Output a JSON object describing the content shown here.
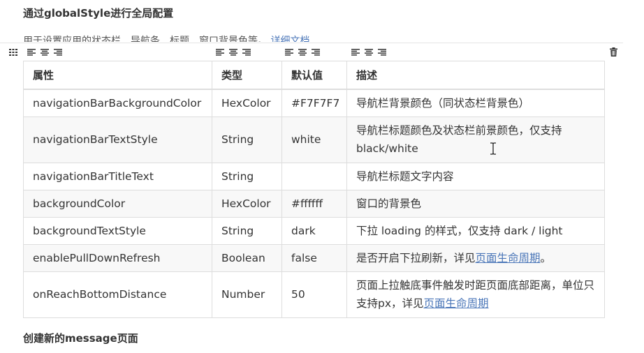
{
  "section_title": "通过globalStyle进行全局配置",
  "intro": {
    "text": "用于设置应用的状态栏、导航条、标题、窗口背景色等。",
    "link": "详细文档"
  },
  "table": {
    "headers": [
      "属性",
      "类型",
      "默认值",
      "描述"
    ],
    "rows": [
      {
        "prop": "navigationBarBackgroundColor",
        "type": "HexColor",
        "default": "#F7F7F7",
        "desc": "导航栏背景颜色（同状态栏背景色）",
        "link": ""
      },
      {
        "prop": "navigationBarTextStyle",
        "type": "String",
        "default": "white",
        "desc": "导航栏标题颜色及状态栏前景颜色，仅支持 black/white",
        "link": ""
      },
      {
        "prop": "navigationBarTitleText",
        "type": "String",
        "default": "",
        "desc": "导航栏标题文字内容",
        "link": ""
      },
      {
        "prop": "backgroundColor",
        "type": "HexColor",
        "default": "#ffffff",
        "desc": "窗口的背景色",
        "link": ""
      },
      {
        "prop": "backgroundTextStyle",
        "type": "String",
        "default": "dark",
        "desc": "下拉 loading 的样式，仅支持 dark / light",
        "link": ""
      },
      {
        "prop": "enablePullDownRefresh",
        "type": "Boolean",
        "default": "false",
        "desc": "是否开启下拉刷新，详见",
        "link": "页面生命周期",
        "suffix": "。"
      },
      {
        "prop": "onReachBottomDistance",
        "type": "Number",
        "default": "50",
        "desc": "页面上拉触底事件触发时距页面底部距离，单位只支持px，详见",
        "link": "页面生命周期",
        "suffix": ""
      }
    ]
  },
  "next_title": "创建新的message页面",
  "icons": {
    "drag": "drag-handle-icon",
    "align_left": "align-left-icon",
    "align_center": "align-center-icon",
    "align_right": "align-right-icon",
    "delete": "trash-icon",
    "cursor": "text-cursor-icon"
  },
  "colors": {
    "link": "#4a76b8",
    "border": "#dddddd",
    "stripe": "#f8f8f8"
  }
}
